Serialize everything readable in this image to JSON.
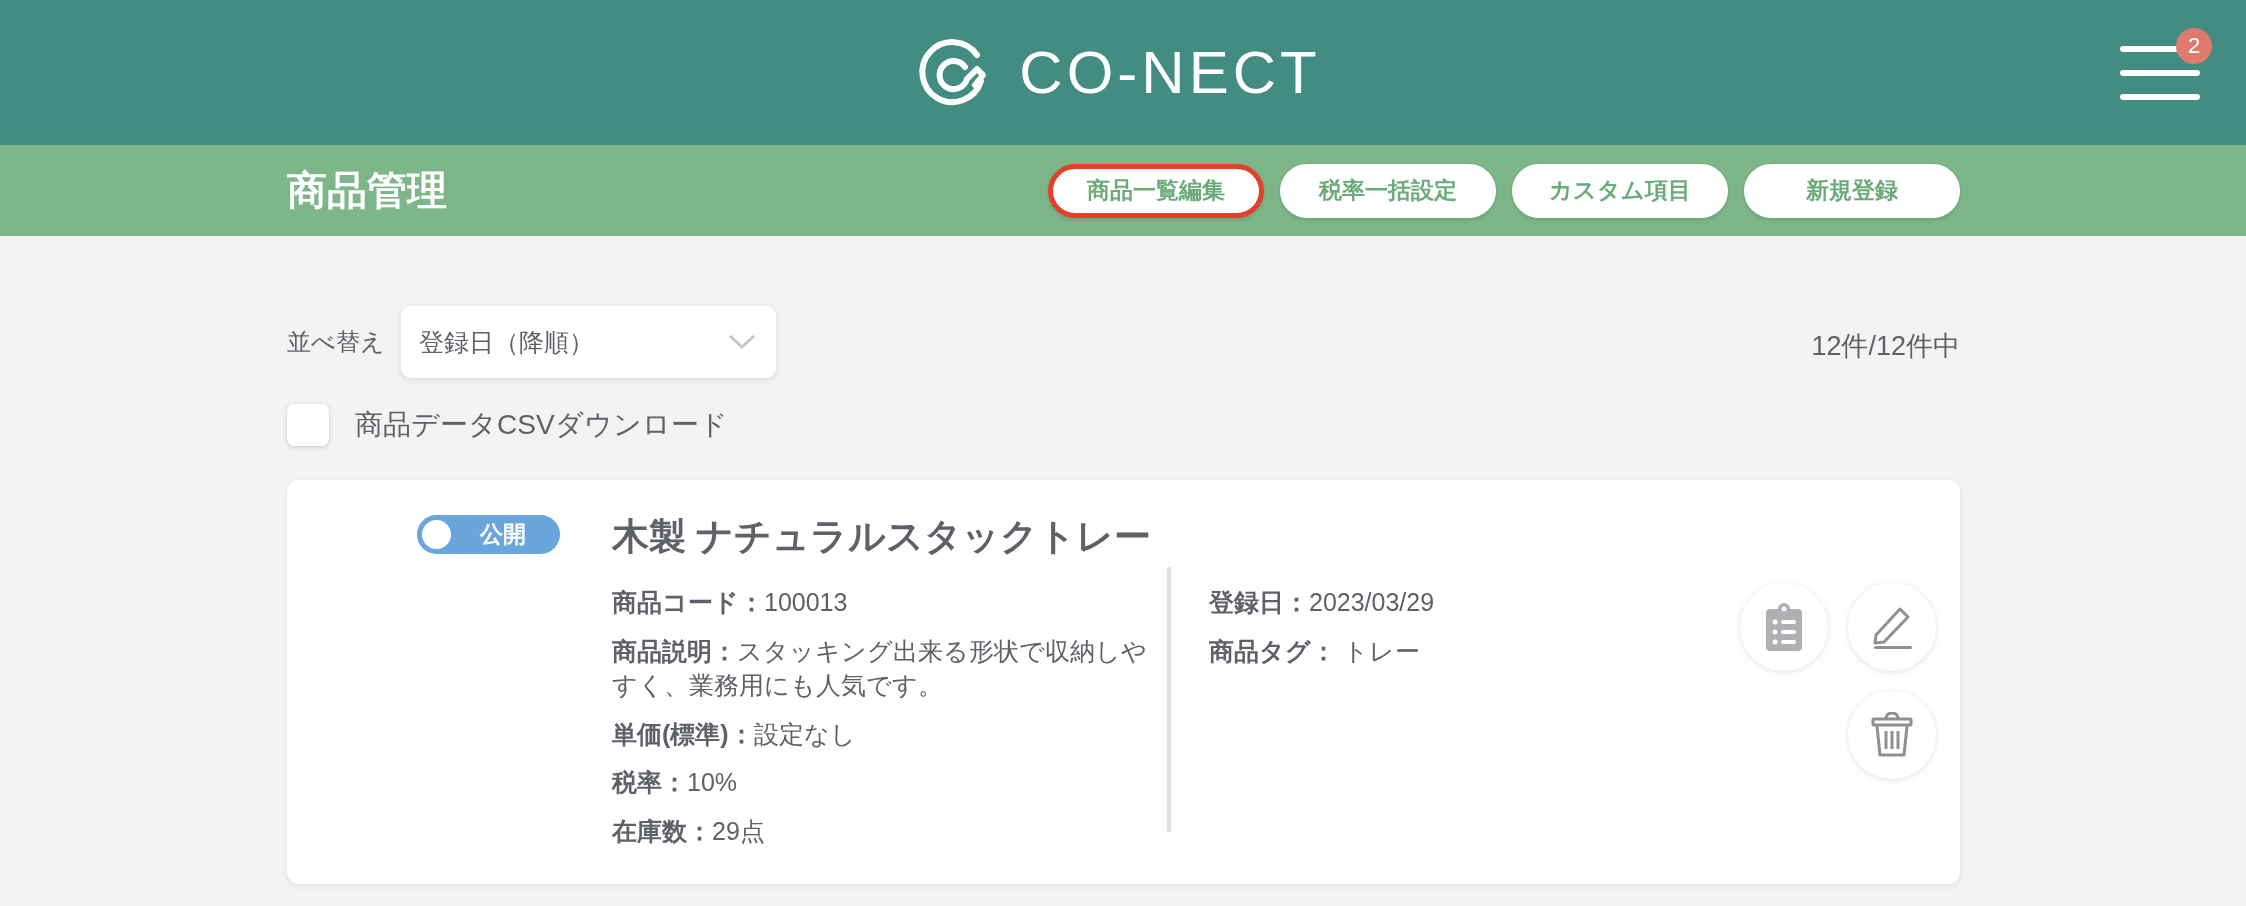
{
  "header": {
    "logo_text": "CO-NECT",
    "notification_count": "2"
  },
  "subheader": {
    "title": "商品管理",
    "buttons": [
      {
        "label": "商品一覧編集",
        "highlighted": true
      },
      {
        "label": "税率一括設定",
        "highlighted": false
      },
      {
        "label": "カスタム項目",
        "highlighted": false
      },
      {
        "label": "新規登録",
        "highlighted": false
      }
    ]
  },
  "sort": {
    "label": "並べ替え",
    "value": "登録日（降順）"
  },
  "result_count": "12件/12件中",
  "csv_download": {
    "label": "商品データCSVダウンロード",
    "checked": false
  },
  "products": [
    {
      "published": true,
      "status_label": "公開",
      "name": "木製 ナチュラルスタックトレー",
      "details_left": [
        {
          "label": "商品コード：",
          "value": "100013"
        },
        {
          "label": "商品説明：",
          "value": "スタッキング出来る形状で収納しやすく、業務用にも人気です。"
        },
        {
          "label": "単価(標準)：",
          "value": "設定なし"
        },
        {
          "label": "税率：",
          "value": "10%"
        },
        {
          "label": "在庫数：",
          "value": "29点"
        }
      ],
      "details_right": [
        {
          "label": "登録日：",
          "value": "2023/03/29"
        },
        {
          "label": "商品タグ：",
          "value": " トレー"
        }
      ]
    }
  ]
}
